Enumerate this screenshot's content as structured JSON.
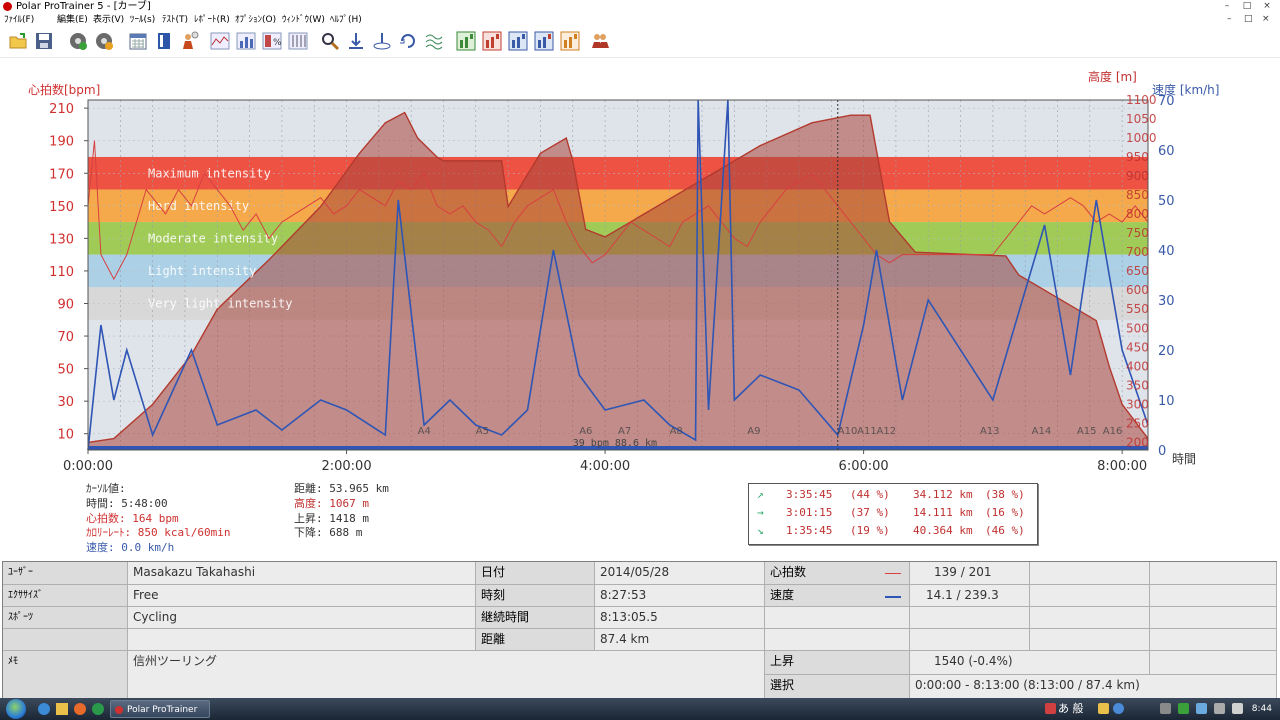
{
  "window": {
    "title": "Polar ProTrainer 5 - [カーブ]",
    "controls": [
      "–",
      "□",
      "×"
    ]
  },
  "menu": {
    "items": [
      "ﾌｧｲﾙ(F)",
      "編集(E)",
      "表示(V)",
      "ﾂｰﾙ(s)",
      "ﾃｽﾄ(T)",
      "ﾚﾎﾟｰﾄ(R)",
      "ｵﾌﾟｼｮﾝ(O)",
      "ｳｨﾝﾄﾞｳ(W)",
      "ﾍﾙﾌﾟ(H)"
    ],
    "doc_controls": [
      "–",
      "□",
      "×"
    ]
  },
  "toolbar": {
    "icons": [
      "open-icon",
      "save-icon",
      "calendar-settings-icon",
      "exercise-settings-icon",
      "calendar-icon",
      "diary-icon",
      "user-icon",
      "curve-icon",
      "bar-chart-icon",
      "percent-icon",
      "columns-icon",
      "zoom-icon",
      "zoom-in-icon",
      "zoom-out-icon",
      "rotate-icon",
      "smooth-icon",
      "report-1-icon",
      "report-2-icon",
      "report-3-icon",
      "report-4-icon",
      "report-5-icon",
      "users-icon"
    ]
  },
  "chart": {
    "left_axis_label": "心拍数[bpm]",
    "right_axis_label_1": "高度 [m]",
    "right_axis_label_2": "速度 [km/h]",
    "bottom_axis_label": "時間",
    "hr_ticks": [
      "210",
      "190",
      "170",
      "150",
      "130",
      "110",
      "90",
      "70",
      "50",
      "30",
      "10"
    ],
    "speed_ticks": [
      "70",
      "60",
      "50",
      "40",
      "30",
      "20",
      "10",
      "0"
    ],
    "alt_ticks": [
      "1100",
      "1050",
      "1000",
      "950",
      "900",
      "850",
      "800",
      "750",
      "700",
      "650",
      "600",
      "550",
      "500",
      "450",
      "400",
      "350",
      "300",
      "250",
      "200"
    ],
    "time_ticks": [
      "0:00:00",
      "2:00:00",
      "4:00:00",
      "6:00:00",
      "8:00:00"
    ],
    "zones": [
      {
        "label": "Maximum intensity",
        "from": 160,
        "to": 180,
        "color": "#ee4a3a"
      },
      {
        "label": "Hard intensity",
        "from": 140,
        "to": 160,
        "color": "#f7a541"
      },
      {
        "label": "Moderate intensity",
        "from": 120,
        "to": 140,
        "color": "#9dc94f"
      },
      {
        "label": "Light intensity",
        "from": 100,
        "to": 120,
        "color": "#a9cfe6"
      },
      {
        "label": "Very light intensity",
        "from": 80,
        "to": 100,
        "color": "#d7d7d7"
      }
    ],
    "lap_markers": [
      "A4",
      "A5",
      "A6",
      "A7",
      "A8",
      "A9",
      "A10",
      "A11",
      "A12",
      "A13",
      "A14",
      "A15",
      "A16"
    ],
    "bottom_note": "39 bpm 88.6 km"
  },
  "chart_data": {
    "type": "line",
    "xlabel": "時間",
    "x_range_hours": [
      0,
      8.2
    ],
    "series": [
      {
        "name": "心拍数",
        "unit": "bpm",
        "color": "#d64040",
        "x": [
          0,
          0.05,
          0.1,
          0.2,
          0.3,
          0.45,
          0.6,
          0.7,
          0.8,
          0.9,
          1.0,
          1.1,
          1.2,
          1.3,
          1.4,
          1.5,
          1.6,
          1.7,
          1.8,
          1.9,
          2.0,
          2.1,
          2.2,
          2.3,
          2.4,
          2.5,
          2.6,
          2.7,
          2.8,
          2.9,
          3.0,
          3.1,
          3.2,
          3.3,
          3.4,
          3.5,
          3.6,
          3.7,
          3.8,
          3.9,
          4.0,
          4.1,
          4.2,
          4.3,
          4.4,
          4.5,
          4.6,
          4.7,
          4.8,
          4.9,
          5.0,
          5.1,
          5.2,
          5.3,
          5.4,
          5.5,
          5.6,
          5.7,
          5.8,
          5.9,
          6.0,
          6.1,
          6.2,
          6.3,
          6.4,
          6.5,
          6.6,
          6.7,
          6.8,
          6.9,
          7.0,
          7.1,
          7.2,
          7.3,
          7.4,
          7.5,
          7.6,
          7.7,
          7.8,
          7.9,
          8.0,
          8.1,
          8.2
        ],
        "values": [
          150,
          190,
          120,
          105,
          120,
          160,
          145,
          160,
          150,
          170,
          160,
          150,
          135,
          145,
          130,
          140,
          145,
          150,
          155,
          145,
          150,
          160,
          155,
          150,
          165,
          160,
          170,
          150,
          145,
          150,
          140,
          135,
          125,
          140,
          150,
          155,
          160,
          140,
          125,
          115,
          120,
          130,
          140,
          135,
          130,
          125,
          140,
          145,
          150,
          140,
          130,
          125,
          140,
          150,
          160,
          165,
          170,
          160,
          150,
          140,
          130,
          120,
          115,
          120,
          120,
          120,
          120,
          120,
          120,
          120,
          120,
          130,
          140,
          150,
          145,
          150,
          155,
          150,
          140,
          145,
          140,
          150,
          140
        ]
      },
      {
        "name": "高度",
        "unit": "m",
        "color": "#b33a2e",
        "x": [
          0,
          0.2,
          0.5,
          0.8,
          1.0,
          1.4,
          1.8,
          2.1,
          2.3,
          2.45,
          2.55,
          2.7,
          2.75,
          3.0,
          3.2,
          3.25,
          3.5,
          3.7,
          3.75,
          3.85,
          4.0,
          4.3,
          4.5,
          4.8,
          5.2,
          5.6,
          5.9,
          6.05,
          6.2,
          6.4,
          7.1,
          7.2,
          7.5,
          7.8,
          7.9,
          8.0,
          8.2
        ],
        "values": [
          200,
          210,
          300,
          430,
          550,
          680,
          820,
          960,
          1040,
          1067,
          1000,
          950,
          940,
          940,
          940,
          820,
          960,
          1000,
          940,
          760,
          740,
          800,
          840,
          900,
          980,
          1040,
          1060,
          1060,
          780,
          700,
          690,
          640,
          580,
          520,
          400,
          300,
          210
        ]
      },
      {
        "name": "速度",
        "unit": "km/h",
        "color": "#2f55b5",
        "x": [
          0,
          0.1,
          0.2,
          0.3,
          0.5,
          0.8,
          1.0,
          1.3,
          1.5,
          1.8,
          2.0,
          2.3,
          2.4,
          2.6,
          2.8,
          3.0,
          3.2,
          3.4,
          3.6,
          3.8,
          4.0,
          4.3,
          4.5,
          4.7,
          4.72,
          4.8,
          4.95,
          5.0,
          5.2,
          5.5,
          5.8,
          6.0,
          6.1,
          6.3,
          6.5,
          7.0,
          7.4,
          7.6,
          7.8,
          8.0,
          8.2
        ],
        "values": [
          0,
          25,
          10,
          20,
          3,
          20,
          5,
          8,
          4,
          10,
          8,
          3,
          50,
          5,
          10,
          5,
          3,
          8,
          40,
          15,
          8,
          10,
          5,
          2,
          70,
          8,
          70,
          10,
          15,
          12,
          3,
          25,
          40,
          10,
          30,
          10,
          45,
          15,
          50,
          20,
          5
        ]
      }
    ],
    "left_axis": {
      "label": "心拍数[bpm]",
      "range": [
        0,
        215
      ]
    },
    "right_axis_speed": {
      "label": "速度 [km/h]",
      "range": [
        0,
        70
      ]
    },
    "right_axis_altitude": {
      "label": "高度 [m]",
      "range": [
        180,
        1100
      ]
    }
  },
  "cursor_values": {
    "title": "ｶｰｿﾙ値:",
    "time": "時間: 5:48:00",
    "hr": "心拍数: 164 bpm",
    "calorie": "ｶﾛﾘｰﾚｰﾄ: 850 kcal/60min",
    "speed": "速度: 0.0 km/h",
    "distance": "距離: 53.965 km",
    "altitude": "高度: 1067 m",
    "ascent": "上昇: 1418 m",
    "descent": "下降: 688 m"
  },
  "incline_table": {
    "rows": [
      {
        "symbol": "↗",
        "time": "3:35:45",
        "time_pct": "(44 %)",
        "dist": "34.112 km",
        "dist_pct": "(38 %)"
      },
      {
        "symbol": "→",
        "time": "3:01:15",
        "time_pct": "(37 %)",
        "dist": "14.111 km",
        "dist_pct": "(16 %)"
      },
      {
        "symbol": "↘",
        "time": "1:35:45",
        "time_pct": "(19 %)",
        "dist": "40.364 km",
        "dist_pct": "(46 %)"
      }
    ]
  },
  "info_grid": {
    "user_label": "ﾕｰｻﾞｰ",
    "user_value": "Masakazu Takahashi",
    "exercise_label": "ｴｸｻｻｲｽﾞ",
    "exercise_value": "Free",
    "sport_label": "ｽﾎﾟｰﾂ",
    "sport_value": "Cycling",
    "memo_label": "ﾒﾓ",
    "memo_value": "信州ツーリング",
    "date_label": "日付",
    "date_value": "2014/05/28",
    "time_label": "時刻",
    "time_value": "8:27:53",
    "duration_label": "継続時間",
    "duration_value": "8:13:05.5",
    "distance_label": "距離",
    "distance_value": "87.4 km",
    "hr_label": "心拍数",
    "hr_value": "139 / 201",
    "speed_label": "速度",
    "speed_value": "14.1 / 239.3",
    "ascent_label": "上昇",
    "ascent_value": "1540 (-0.4%)",
    "selection_label": "選択",
    "selection_value": "0:00:00 - 8:13:00 (8:13:00 / 87.4 km)"
  },
  "taskbar": {
    "task_label": "Polar ProTrainer 5...",
    "ime_text": "あ 般",
    "clock": "8:44"
  },
  "colors": {
    "hr": "#d64040",
    "altitude_fill": "#a8453a",
    "speed": "#2f55b5"
  }
}
